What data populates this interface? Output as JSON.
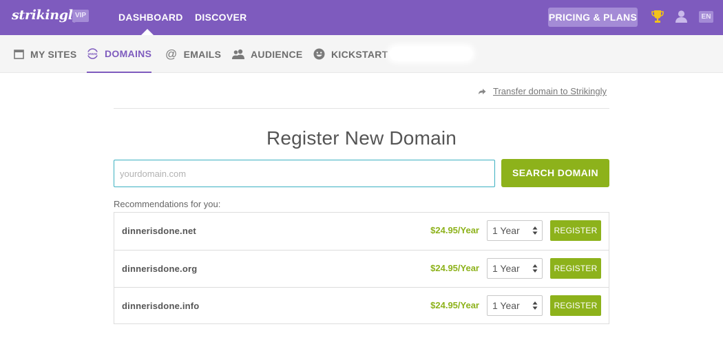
{
  "header": {
    "logo": "strikingly",
    "vip_badge": "VIP",
    "nav": [
      "DASHBOARD",
      "DISCOVER"
    ],
    "pricing_label": "PRICING & PLANS",
    "language": "EN",
    "bg_color": "#7e5bbe"
  },
  "subnav": {
    "tabs": [
      {
        "label": "MY SITES",
        "icon": "browser-window-icon"
      },
      {
        "label": "DOMAINS",
        "icon": "www-globe-icon",
        "active": true
      },
      {
        "label": "EMAILS",
        "icon": "at-icon"
      },
      {
        "label": "AUDIENCE",
        "icon": "people-icon"
      },
      {
        "label": "KICKSTART",
        "icon": "smiley-icon"
      }
    ]
  },
  "transfer_link": "Transfer domain to Strikingly",
  "register": {
    "title": "Register New Domain",
    "placeholder": "yourdomain.com",
    "value": "",
    "search_button": "SEARCH DOMAIN"
  },
  "recommendations": {
    "label": "Recommendations for you:",
    "rows": [
      {
        "domain": "dinnerisdone.net",
        "price": "$24.95/Year",
        "term": "1 Year",
        "button": "REGISTER"
      },
      {
        "domain": "dinnerisdone.org",
        "price": "$24.95/Year",
        "term": "1 Year",
        "button": "REGISTER"
      },
      {
        "domain": "dinnerisdone.info",
        "price": "$24.95/Year",
        "term": "1 Year",
        "button": "REGISTER"
      }
    ]
  },
  "colors": {
    "accent_purple": "#7e5bbe",
    "action_green": "#8db21b",
    "input_border": "#3bb0c1"
  }
}
